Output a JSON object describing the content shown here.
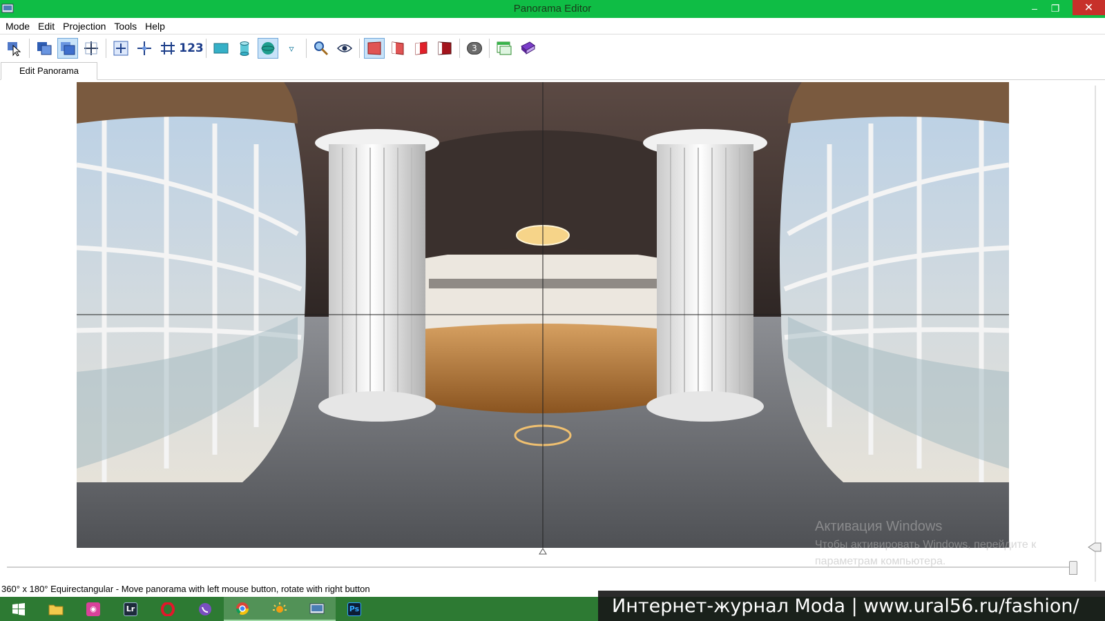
{
  "window": {
    "title": "Panorama Editor",
    "minimize_glyph": "–",
    "maximize_glyph": "❐",
    "close_glyph": "✕"
  },
  "menu": {
    "items": [
      "Mode",
      "Edit",
      "Projection",
      "Tools",
      "Help"
    ]
  },
  "toolbar": {
    "number_button_label": "123",
    "badge_label": "3",
    "dropdown_glyph": "▿"
  },
  "tabs": {
    "active": "Edit Panorama"
  },
  "watermark": {
    "line1": "Активация Windows",
    "line2": "Чтобы активировать Windows, перейдите к",
    "line3": "параметрам компьютера."
  },
  "status": {
    "text": "360° x 180° Equirectangular - Move panorama with left mouse button, rotate with right button"
  },
  "banner": {
    "text": "Интернет-журнал Moda | www.ural56.ru/fashion/"
  },
  "taskbar": {
    "lightroom_label": "Lr",
    "photoshop_label": "Ps"
  },
  "colors": {
    "titlebar": "#0fbd45",
    "taskbar": "#2d7a33",
    "close_button": "#c7302a",
    "toolbar_active": "#c8e3f9"
  }
}
